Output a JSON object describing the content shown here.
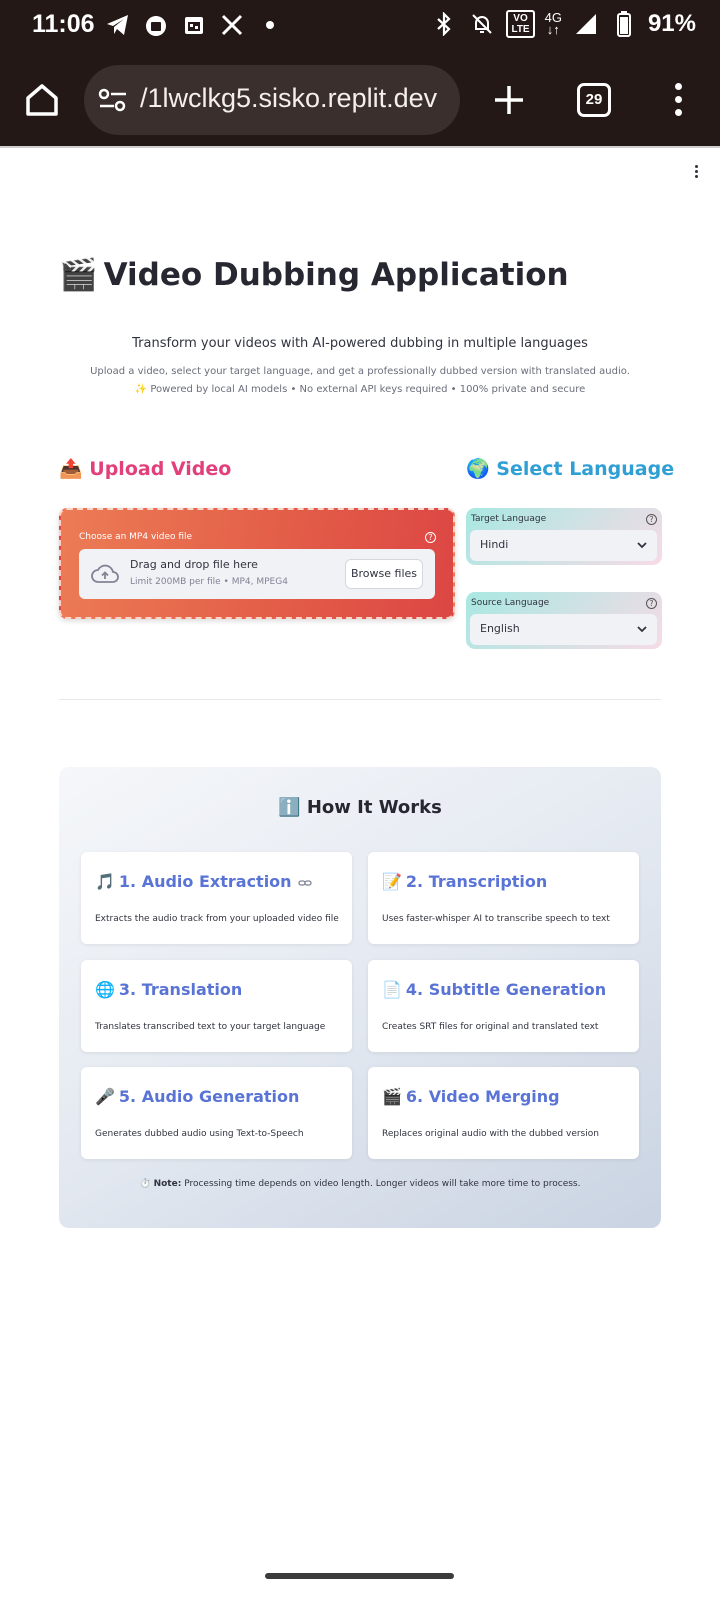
{
  "status_bar": {
    "time": "11:06",
    "network": "4G",
    "volte": "VO\nLTE",
    "battery": "91%",
    "left_icons": [
      "telegram-icon",
      "shopping-bag-icon",
      "calendar-icon",
      "x-icon",
      "dot-icon"
    ],
    "right_icons": [
      "bluetooth-icon",
      "bell-off-icon",
      "volte-icon",
      "network-icon",
      "signal-icon",
      "battery-icon"
    ]
  },
  "browser": {
    "url": "/1lwclkg5.sisko.replit.dev",
    "tab_count": "29"
  },
  "page": {
    "title_emoji": "🎬",
    "title": "Video Dubbing Application",
    "subtitle": "Transform your videos with AI-powered dubbing in multiple languages",
    "line1": "Upload a video, select your target language, and get a professionally dubbed version with translated audio.",
    "line2": "✨ Powered by local AI models • No external API keys required • 100% private and secure"
  },
  "upload": {
    "heading": "📤 Upload Video",
    "label": "Choose an MP4 video file",
    "drop_title": "Drag and drop file here",
    "drop_limit": "Limit 200MB per file • MP4, MPEG4",
    "browse_label": "Browse files"
  },
  "language": {
    "heading": "🌍 Select Language",
    "target_label": "Target Language",
    "target_value": "Hindi",
    "source_label": "Source Language",
    "source_value": "English"
  },
  "how_it_works": {
    "title": "ℹ️ How It Works",
    "steps": [
      {
        "emoji": "🎵",
        "title": "1. Audio Extraction",
        "desc": "Extracts the audio track from your uploaded video file"
      },
      {
        "emoji": "📝",
        "title": "2. Transcription",
        "desc": "Uses faster-whisper AI to transcribe speech to text"
      },
      {
        "emoji": "🌐",
        "title": "3. Translation",
        "desc": "Translates transcribed text to your target language"
      },
      {
        "emoji": "📄",
        "title": "4. Subtitle Generation",
        "desc": "Creates SRT files for original and translated text"
      },
      {
        "emoji": "🎤",
        "title": "5. Audio Generation",
        "desc": "Generates dubbed audio using Text-to-Speech"
      },
      {
        "emoji": "🎬",
        "title": "6. Video Merging",
        "desc": "Replaces original audio with the dubbed version"
      }
    ],
    "note_prefix": "⏱️",
    "note_label": "Note:",
    "note_text": "Processing time depends on video length. Longer videos will take more time to process."
  }
}
